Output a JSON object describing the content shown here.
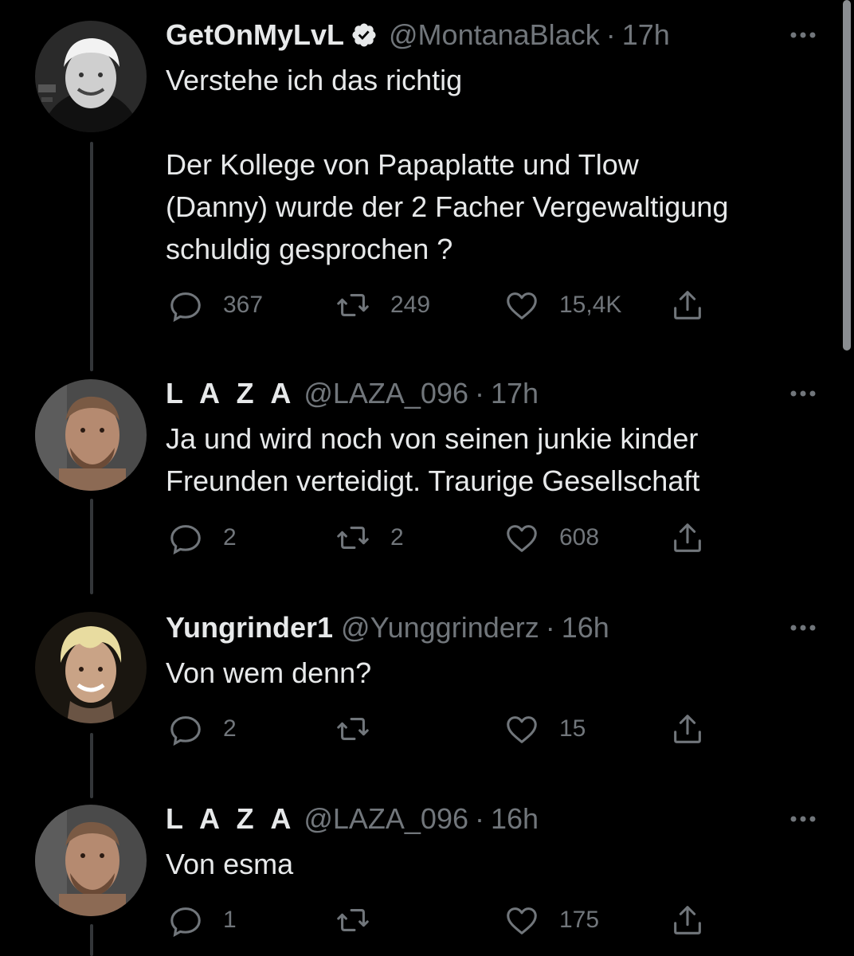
{
  "tweets": [
    {
      "display_name": "GetOnMyLvL",
      "verified": true,
      "handle": "@MontanaBlack",
      "separator": "·",
      "time": "17h",
      "text": "Verstehe ich das richtig\n\nDer Kollege von Papaplatte und Tlow\n(Danny) wurde der 2 Facher Vergewaltigung\nschuldig gesprochen ?",
      "replies": "367",
      "retweets": "249",
      "likes": "15,4K"
    },
    {
      "display_name": "L A Z A",
      "verified": false,
      "handle": "@LAZA_096",
      "separator": "·",
      "time": "17h",
      "text": "Ja und wird noch von seinen junkie kinder\nFreunden verteidigt. Traurige Gesellschaft",
      "replies": "2",
      "retweets": "2",
      "likes": "608"
    },
    {
      "display_name": "Yungrinder1",
      "verified": false,
      "handle": "@Yunggrinderz",
      "separator": "·",
      "time": "16h",
      "text": "Von wem denn?",
      "replies": "2",
      "retweets": "",
      "likes": "15"
    },
    {
      "display_name": "L A Z A",
      "verified": false,
      "handle": "@LAZA_096",
      "separator": "·",
      "time": "16h",
      "text": "Von esma",
      "replies": "1",
      "retweets": "",
      "likes": "175"
    }
  ],
  "icons": {
    "avatar_1": "avatar-image",
    "verified": "verified-badge-icon",
    "more": "more-options-icon",
    "reply": "reply-icon",
    "retweet": "retweet-icon",
    "like": "heart-icon",
    "share": "share-icon"
  },
  "colors": {
    "background": "#000000",
    "primary_text": "#e7e9ea",
    "secondary_text": "#71767b",
    "thread_line": "#333639"
  }
}
